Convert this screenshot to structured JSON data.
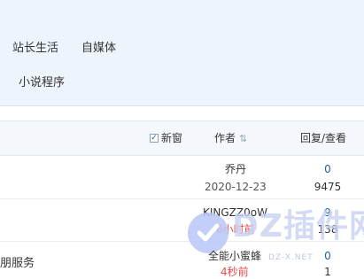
{
  "categories": [
    "站长生活",
    "自媒体",
    "小说程序"
  ],
  "header": {
    "new_window_label": "新窗",
    "new_window_checked": true,
    "author_label": "作者",
    "reply_view_label": "回复/查看"
  },
  "rows": [
    {
      "title": "",
      "author": "乔丹",
      "date": "2020-12-23",
      "replies": "0",
      "views": "9475"
    },
    {
      "title": "",
      "author": "KINGZZ0oW",
      "date": "6小时前",
      "replies": "9",
      "views": "138"
    },
    {
      "title": "朋服务",
      "author": "全能小蜜蜂",
      "date": "4秒前",
      "replies": "0",
      "views": "1"
    }
  ],
  "watermark": {
    "text": "DZ插件网",
    "sub": "DZ-X.NET"
  },
  "colors": {
    "link_blue": "#1e5fa8",
    "recent_red": "#e34b4b",
    "panel_bg": "#eef4fb"
  }
}
